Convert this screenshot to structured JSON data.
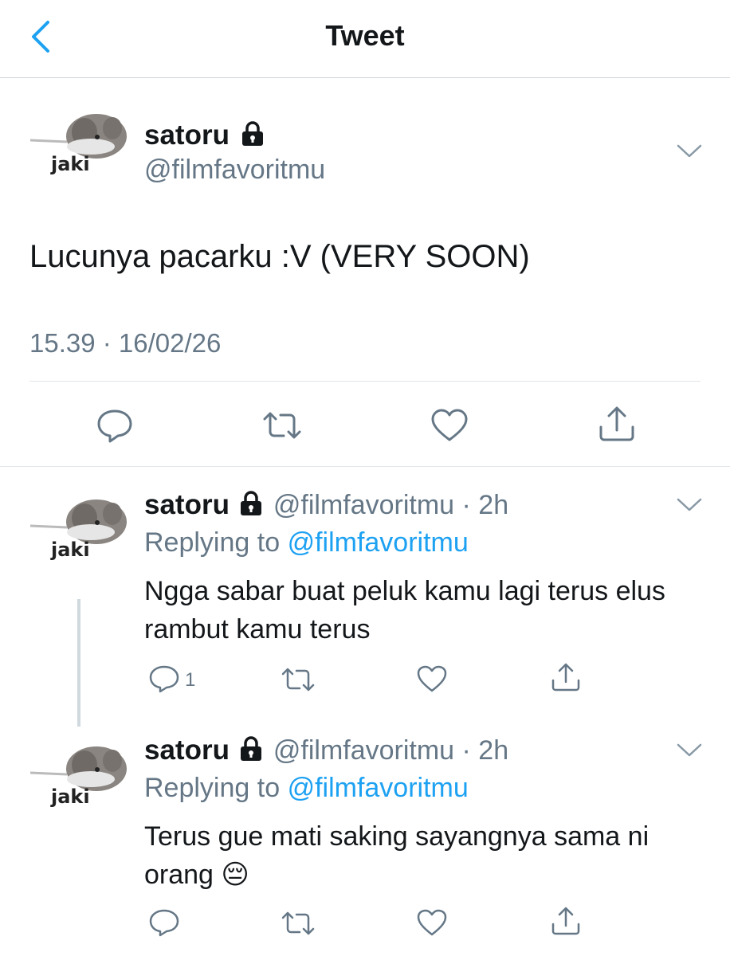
{
  "header": {
    "title": "Tweet",
    "back_icon": "chevron-left-icon"
  },
  "colors": {
    "accent": "#1da1f2",
    "secondary_text": "#657786",
    "primary_text": "#14171a",
    "divider": "#e1e5e8"
  },
  "avatar_label": "jaki",
  "main_tweet": {
    "name": "satoru",
    "handle": "@filmfavoritmu",
    "text": "Lucunya pacarku :V (VERY SOON)",
    "timestamp": "15.39 · 16/02/26"
  },
  "replies": [
    {
      "name": "satoru",
      "handle": "@filmfavoritmu · 2h",
      "replying_label": "Replying to",
      "replying_to": "@filmfavoritmu",
      "text": "Ngga sabar buat peluk kamu lagi terus elus rambut kamu terus",
      "reply_count": "1"
    },
    {
      "name": "satoru",
      "handle": "@filmfavoritmu · 2h",
      "replying_label": "Replying to",
      "replying_to": "@filmfavoritmu",
      "text": "Terus gue mati saking sayangnya sama ni orang 😔",
      "reply_count": ""
    }
  ]
}
